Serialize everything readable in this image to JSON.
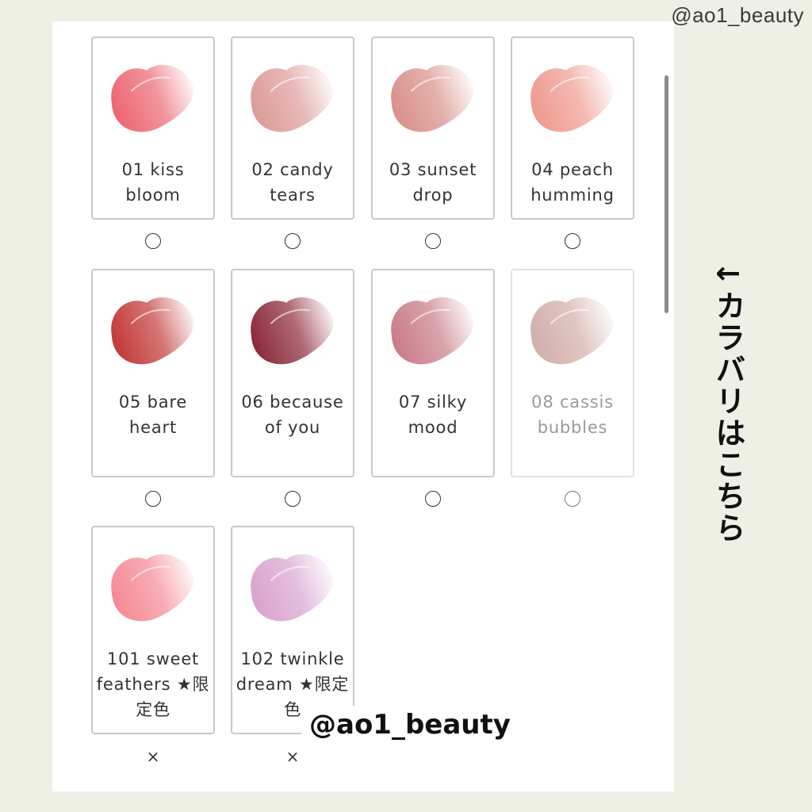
{
  "watermarks": {
    "top": "@ao1_beauty",
    "overlay": "@ao1_beauty"
  },
  "side_note": {
    "arrow": "←",
    "text": "カラバリはこちら"
  },
  "colors": {
    "01": "#ec6672",
    "02": "#dd9b98",
    "03": "#d9908a",
    "04": "#ef9a8f",
    "05": "#c23a38",
    "06": "#8c2a3a",
    "07": "#c97c88",
    "08": "#d2aeaa",
    "101": "#f58a94",
    "102": "#d9a3cf"
  },
  "shades": [
    {
      "label": "01 kiss bloom",
      "selector": "○",
      "available": true
    },
    {
      "label": "02 candy tears",
      "selector": "○",
      "available": true
    },
    {
      "label": "03 sunset drop",
      "selector": "○",
      "available": true
    },
    {
      "label": "04 peach humming",
      "selector": "○",
      "available": true
    },
    {
      "label": "05 bare heart",
      "selector": "○",
      "available": true
    },
    {
      "label": "06 because of you",
      "selector": "○",
      "available": true
    },
    {
      "label": "07 silky mood",
      "selector": "○",
      "available": true
    },
    {
      "label": "08 cassis bubbles",
      "selector": "○",
      "available": false
    },
    {
      "label": "101 sweet feathers ★限定色",
      "selector": "×",
      "available": false
    },
    {
      "label": "102 twinkle dream ★限定色",
      "selector": "×",
      "available": false
    }
  ]
}
